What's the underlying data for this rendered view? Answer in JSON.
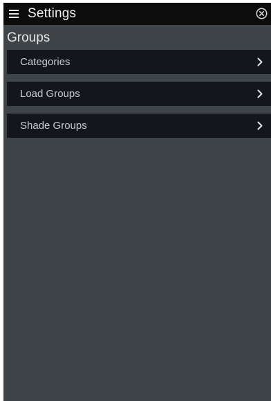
{
  "header": {
    "title": "Settings"
  },
  "section": {
    "title": "Groups"
  },
  "items": [
    {
      "label": "Categories"
    },
    {
      "label": "Load Groups"
    },
    {
      "label": "Shade Groups"
    }
  ],
  "icons": {
    "menu": "hamburger-menu-icon",
    "close": "close-circle-icon",
    "chevron": "chevron-right-icon"
  },
  "colors": {
    "topbar": "#0c0c0d",
    "background": "#3f4449",
    "item_background": "#13171d",
    "text": "#c9ccd0"
  }
}
